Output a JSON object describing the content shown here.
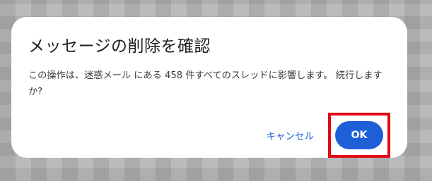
{
  "dialog": {
    "title": "メッセージの削除を確認",
    "message": "この操作は、迷惑メール にある 458 件すべてのスレッドに影響します。 続行しますか?",
    "cancel_label": "キャンセル",
    "ok_label": "OK"
  },
  "colors": {
    "primary": "#1e5fd8",
    "highlight_box": "#e30613"
  }
}
